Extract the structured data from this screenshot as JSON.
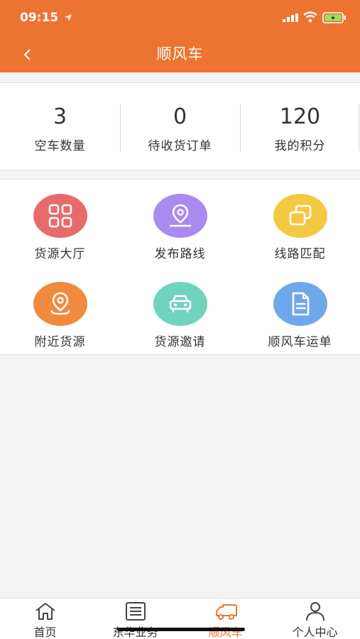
{
  "status_bar": {
    "time": "09:15"
  },
  "nav": {
    "title": "顺风车",
    "back_icon": "chevron-left-icon"
  },
  "stats": [
    {
      "value": "3",
      "label": "空车数量"
    },
    {
      "value": "0",
      "label": "待收货订单"
    },
    {
      "value": "120",
      "label": "我的积分"
    }
  ],
  "grid": [
    {
      "label": "货源大厅",
      "icon": "grid-four-icon",
      "color": "#e86b6b"
    },
    {
      "label": "发布路线",
      "icon": "location-pin-icon",
      "color": "#a98aef"
    },
    {
      "label": "线路匹配",
      "icon": "overlap-squares-icon",
      "color": "#f5c842"
    },
    {
      "label": "附近货源",
      "icon": "location-pin-icon",
      "color": "#ef8a3e"
    },
    {
      "label": "货源邀请",
      "icon": "car-icon",
      "color": "#6fd3be"
    },
    {
      "label": "顺风车运单",
      "icon": "document-icon",
      "color": "#6fa8ea"
    }
  ],
  "tabs": [
    {
      "label": "首页",
      "icon": "home-icon",
      "active": false
    },
    {
      "label": "东华业务",
      "icon": "list-icon",
      "active": false
    },
    {
      "label": "顺风车",
      "icon": "truck-icon",
      "active": true
    },
    {
      "label": "个人中心",
      "icon": "user-icon",
      "active": false
    }
  ],
  "colors": {
    "brand": "#ed7430",
    "background": "#f4f4f4"
  }
}
